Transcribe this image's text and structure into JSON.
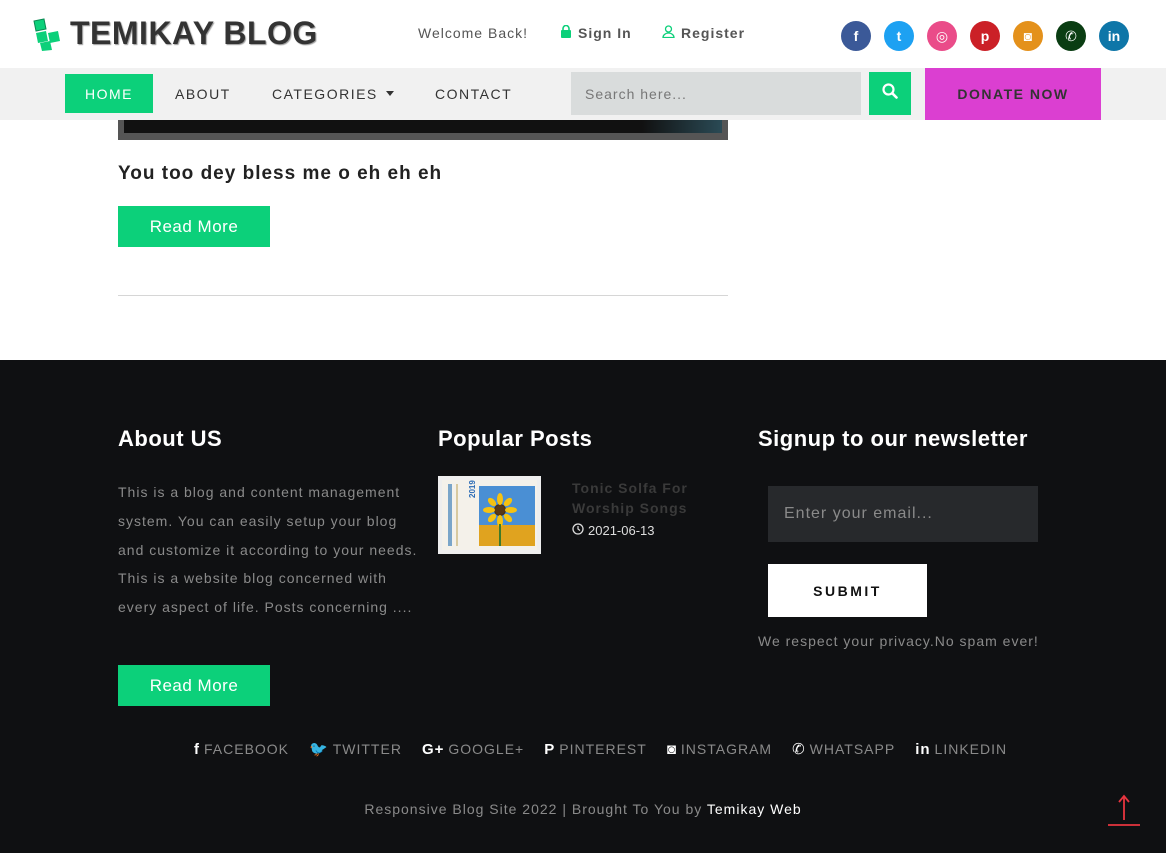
{
  "header": {
    "logo_text": "TEMIKAY BLOG",
    "welcome": "Welcome Back!",
    "signin": "Sign In",
    "register": "Register",
    "social": [
      {
        "icon": "facebook-icon",
        "glyph": "f",
        "color": "#3b5998"
      },
      {
        "icon": "twitter-icon",
        "glyph": "t",
        "color": "#1da1f2"
      },
      {
        "icon": "dribbble-icon",
        "glyph": "◎",
        "color": "#ea4c89"
      },
      {
        "icon": "pinterest-icon",
        "glyph": "p",
        "color": "#cb2027"
      },
      {
        "icon": "instagram-icon",
        "glyph": "◙",
        "color": "#e4911b"
      },
      {
        "icon": "whatsapp-icon",
        "glyph": "✆",
        "color": "#0a3d12"
      },
      {
        "icon": "linkedin-icon",
        "glyph": "in",
        "color": "#0e76a8"
      }
    ]
  },
  "nav": {
    "home": "HOME",
    "about": "ABOUT",
    "categories": "CATEGORIES",
    "contact": "CONTACT",
    "search_placeholder": "Search here...",
    "donate": "DONATE NOW"
  },
  "post": {
    "title": "You too dey bless me o eh eh eh",
    "read_more": "Read More"
  },
  "footer": {
    "about_heading": "About US",
    "about_text": "This is a blog and content management system. You can easily setup your blog and customize it according to your needs. This is a website blog concerned with every aspect of life. Posts concerning ....",
    "about_read_more": "Read More",
    "popular_heading": "Popular Posts",
    "popular_post": {
      "title": "Tonic Solfa For Worship Songs",
      "date": "2021-06-13",
      "thumb_year": "2019"
    },
    "newsletter_heading": "Signup to our newsletter",
    "email_placeholder": "Enter your email...",
    "submit": "SUBMIT",
    "privacy": "We respect your privacy.No spam ever!",
    "social_links": [
      {
        "icon": "facebook-icon",
        "glyph": "f",
        "label": "FACEBOOK"
      },
      {
        "icon": "twitter-icon",
        "glyph": "🐦",
        "label": "TWITTER"
      },
      {
        "icon": "google-plus-icon",
        "glyph": "G+",
        "label": "GOOGLE+"
      },
      {
        "icon": "pinterest-icon",
        "glyph": "P",
        "label": "PINTEREST"
      },
      {
        "icon": "instagram-icon",
        "glyph": "◙",
        "label": "INSTAGRAM"
      },
      {
        "icon": "whatsapp-icon",
        "glyph": "✆",
        "label": "WHATSAPP"
      },
      {
        "icon": "linkedin-icon",
        "glyph": "in",
        "label": "LINKEDIN"
      }
    ],
    "copyright_prefix": "Responsive Blog Site 2022 | Brought To You by",
    "copyright_brand": "Temikay Web"
  },
  "colors": {
    "accent": "#0cd07a",
    "donate": "#db3fd1",
    "footer_bg": "#0f1012",
    "back_to_top": "#e8353f"
  }
}
